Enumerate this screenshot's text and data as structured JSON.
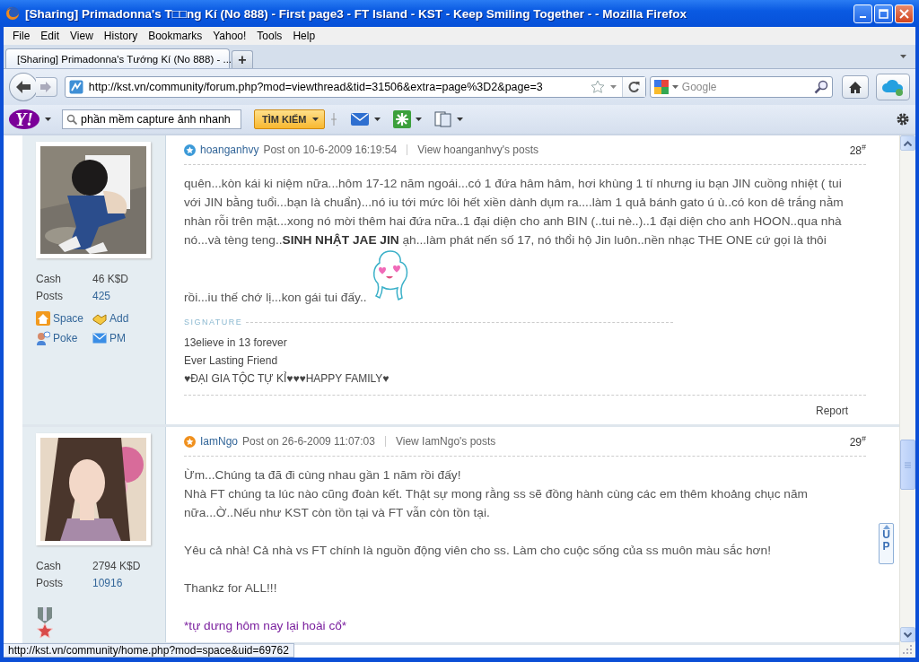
{
  "window": {
    "title": "[Sharing] Primadonna's T□□ng Kí (No 888) - First page3 - FT Island - KST - Keep Smiling Together - - Mozilla Firefox"
  },
  "menu": [
    "File",
    "Edit",
    "View",
    "History",
    "Bookmarks",
    "Yahoo!",
    "Tools",
    "Help"
  ],
  "tabs": [
    {
      "label": "[Sharing] Primadonna's Tướng Kí (No 888) - ...",
      "selected": true
    }
  ],
  "new_tab": "+",
  "address": {
    "url": "http://kst.vn/community/forum.php?mod=viewthread&tid=31506&extra=page%3D2&page=3"
  },
  "web_search": {
    "placeholder": "Google"
  },
  "yahoo_toolbar": {
    "logo": "Y!",
    "query": "phần mềm capture ảnh nhanh",
    "search_button": "TÌM KIẾM"
  },
  "posts": [
    {
      "author": "hoanganhvy",
      "posted": "Post on 10-6-2009 16:19:54",
      "view_posts": "View hoanganhvy's posts",
      "number": "28",
      "number_mark": "#",
      "color": "#3c9ad8",
      "avatar": {
        "kind": "picture"
      },
      "stats": [
        {
          "label": "Cash",
          "value": "46 K$D",
          "link": false
        },
        {
          "label": "Posts",
          "value": "425",
          "link": true
        }
      ],
      "actions": [
        {
          "kind": "space",
          "label": "Space"
        },
        {
          "kind": "add",
          "label": "Add"
        },
        {
          "kind": "poke",
          "label": "Poke"
        },
        {
          "kind": "pm",
          "label": "PM"
        }
      ],
      "body": [
        {
          "kind": "line",
          "text": "quên...kòn kái ki niệm nữa...hôm 17-12 năm ngoái...có 1 đứa hâm hâm, hơi khùng 1 tí nhưng iu bạn JIN cuồng nhiệt ( tui với JIN bằng tuổi...bạn là chuẩn)...nó iu tới mức lôi hết xiền dành dụm ra....làm 1 quả bánh gato ú ù..có kon dê trắng nằm nhàn rỗi trên mặt...xong nó mời thêm hai đứa nữa..1 đại diện cho anh BIN (..tui nè..)..1 đại diện cho anh HOON..qua nhà nó...và tèng teng..**SINH NHẬT JAE JIN** ạh...làm phát nến số 17, nó thổi hộ Jin luôn..nền nhạc THE ONE cứ gọi là thôi"
        },
        {
          "kind": "line",
          "text": "rồi...iu thế chớ lị...kon gái tui đấy..",
          "emoticon": true
        }
      ],
      "signature": {
        "heading": "SIGNATURE",
        "lines": [
          "13elieve in 13 forever",
          "Ever Lasting Friend",
          "♥ĐẠI GIA TỘC TỰ KỈ♥♥♥HAPPY FAMILY♥"
        ]
      },
      "report": "Report"
    },
    {
      "author": "IamNgo",
      "posted": "Post on 26-6-2009 11:07:03",
      "view_posts": "View IamNgo's posts",
      "number": "29",
      "number_mark": "#",
      "color": "#f0901e",
      "avatar": {
        "kind": "picture"
      },
      "stats": [
        {
          "label": "Cash",
          "value": "2794 K$D",
          "link": false
        },
        {
          "label": "Posts",
          "value": "10916",
          "link": true
        }
      ],
      "medal": true,
      "body": [
        {
          "kind": "line",
          "text": "Ừm...Chúng ta đã đi cùng nhau gần 1 năm rồi đấy!"
        },
        {
          "kind": "line",
          "text": "Nhà FT chúng ta lúc nào cũng đoàn kết. Thật sự mong rằng ss sẽ đồng hành cùng các em thêm khoảng chục năm nữa...Ờ..Nếu như KST còn tồn tại và FT vẫn còn tồn tại."
        },
        {
          "kind": "paragraph",
          "text": "Yêu cả nhà! Cả nhà vs FT chính là nguồn động viên cho ss. Làm cho cuộc sống của ss muôn màu sắc hơn!"
        },
        {
          "kind": "paragraph",
          "text": "Thankz for ALL!!!"
        },
        {
          "kind": "emphasis",
          "text": "*tự dưng hôm nay lại hoài cổ*"
        }
      ]
    }
  ],
  "go_top": "UP",
  "status_text": "http://kst.vn/community/home.php?mod=space&uid=69762"
}
